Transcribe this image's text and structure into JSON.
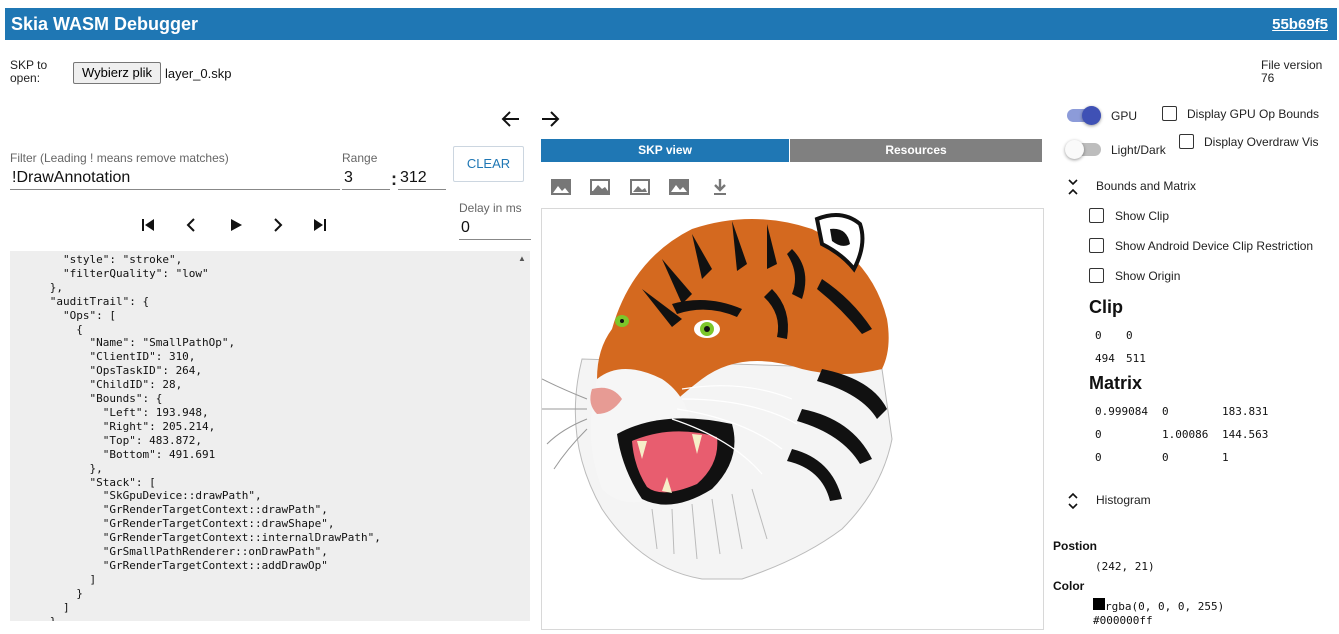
{
  "header": {
    "title": "Skia WASM Debugger",
    "version": "55b69f5",
    "color": "#1f77b4"
  },
  "file": {
    "label_line1": "SKP to",
    "label_line2": "open:",
    "choose_button": "Wybierz plik",
    "filename": "layer_0.skp",
    "version_label": "File version",
    "version_value": "76"
  },
  "nav": {
    "back_icon": "arrow-left-icon",
    "forward_icon": "arrow-right-icon"
  },
  "filter": {
    "label": "Filter (Leading ! means remove matches)",
    "value": "!DrawAnnotation",
    "range_label": "Range",
    "range_start": "3",
    "range_sep": ":",
    "range_end": "312",
    "clear_label": "CLEAR",
    "delay_label": "Delay in ms",
    "delay_value": "0"
  },
  "playback": {
    "first": "⏮",
    "prev": "‹",
    "play": "▶",
    "next": "›",
    "last": "⏭"
  },
  "json_text": "        \"style\": \"stroke\",\n        \"filterQuality\": \"low\"\n      },\n      \"auditTrail\": {\n        \"Ops\": [\n          {\n            \"Name\": \"SmallPathOp\",\n            \"ClientID\": 310,\n            \"OpsTaskID\": 264,\n            \"ChildID\": 28,\n            \"Bounds\": {\n              \"Left\": 193.948,\n              \"Right\": 205.214,\n              \"Top\": 483.872,\n              \"Bottom\": 491.691\n            },\n            \"Stack\": [\n              \"SkGpuDevice::drawPath\",\n              \"GrRenderTargetContext::drawPath\",\n              \"GrRenderTargetContext::drawShape\",\n              \"GrRenderTargetContext::internalDrawPath\",\n              \"GrSmallPathRenderer::onDrawPath\",\n              \"GrRenderTargetContext::addDrawOp\"\n            ]\n          }\n        ]\n      }",
  "tabs": {
    "skp_view": "SKP view",
    "resources": "Resources"
  },
  "toolbar_icons": [
    "image-icon",
    "image-outline-icon",
    "image-dark-icon",
    "image-filled-icon",
    "download-icon"
  ],
  "settings": {
    "gpu_label": "GPU",
    "gpu_on": true,
    "lightdark_label": "Light/Dark",
    "lightdark_on": false,
    "gpu_op_bounds_label": "Display GPU Op Bounds",
    "overdraw_label": "Display Overdraw Vis",
    "bounds_matrix_label": "Bounds and Matrix",
    "show_clip_label": "Show Clip",
    "show_android_clip_label": "Show Android Device Clip Restriction",
    "show_origin_label": "Show Origin"
  },
  "clip": {
    "title": "Clip",
    "rows": [
      [
        "0",
        "0"
      ],
      [
        "494",
        "511"
      ]
    ]
  },
  "matrix": {
    "title": "Matrix",
    "rows": [
      [
        "0.999084",
        "0",
        "183.831"
      ],
      [
        "0",
        "1.00086",
        "144.563"
      ],
      [
        "0",
        "0",
        "1"
      ]
    ]
  },
  "histogram": {
    "label": "Histogram"
  },
  "position": {
    "label": "Postion",
    "value": "(242, 21)"
  },
  "color": {
    "label": "Color",
    "value": "rgba(0, 0, 0, 255)",
    "hex": "#000000ff",
    "swatch": "#000000"
  },
  "accent": "#3f51b5"
}
